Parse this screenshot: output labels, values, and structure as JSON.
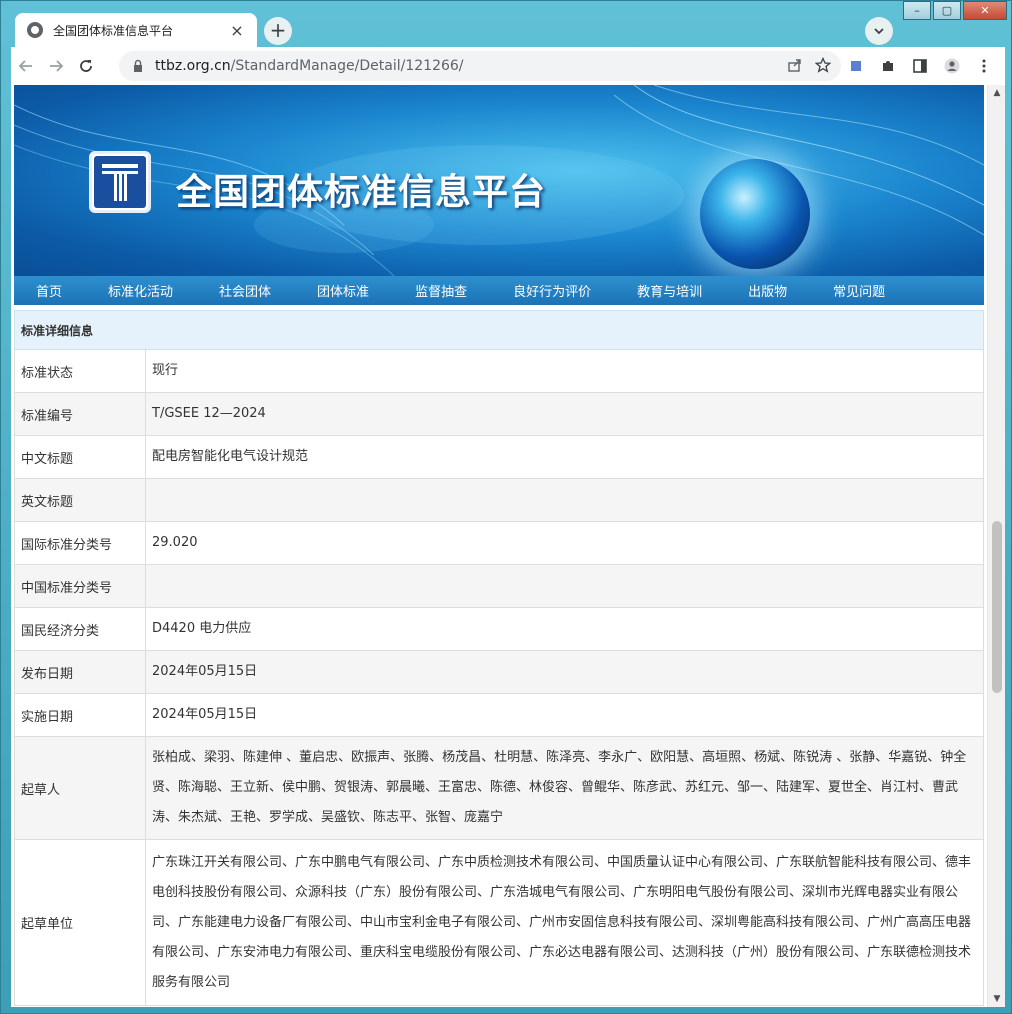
{
  "browser": {
    "tab_title": "全国团体标准信息平台",
    "url_host": "ttbz.org.cn",
    "url_path": "/StandardManage/Detail/121266/"
  },
  "site": {
    "title": "全国团体标准信息平台"
  },
  "nav": [
    "首页",
    "标准化活动",
    "社会团体",
    "团体标准",
    "监督抽查",
    "良好行为评价",
    "教育与培训",
    "出版物",
    "常见问题"
  ],
  "detail": {
    "header": "标准详细信息",
    "rows": [
      {
        "label": "标准状态",
        "value": "现行"
      },
      {
        "label": "标准编号",
        "value": "T/GSEE 12—2024"
      },
      {
        "label": "中文标题",
        "value": "配电房智能化电气设计规范"
      },
      {
        "label": "英文标题",
        "value": ""
      },
      {
        "label": "国际标准分类号",
        "value": "29.020"
      },
      {
        "label": "中国标准分类号",
        "value": ""
      },
      {
        "label": "国民经济分类",
        "value": "D4420 电力供应"
      },
      {
        "label": "发布日期",
        "value": "2024年05月15日"
      },
      {
        "label": "实施日期",
        "value": "2024年05月15日"
      },
      {
        "label": "起草人",
        "value": "张柏成、梁羽、陈建伸 、董启忠、欧振声、张腾、杨茂昌、杜明慧、陈泽亮、李永广、欧阳慧、高垣照、杨斌、陈锐涛 、张静、华嘉锐、钟全贤、陈海聪、王立新、侯中鹏、贺银涛、郭晨曦、王富忠、陈德、林俊容、曾鲲华、陈彦武、苏红元、邹一、陆建军、夏世全、肖江村、曹武涛、朱杰斌、王艳、罗学成、吴盛钦、陈志平、张智、庞嘉宁"
      },
      {
        "label": "起草单位",
        "value": "广东珠江开关有限公司、广东中鹏电气有限公司、广东中质检测技术有限公司、中国质量认证中心有限公司、广东联航智能科技有限公司、德丰电创科技股份有限公司、众源科技（广东）股份有限公司、广东浩城电气有限公司、广东明阳电气股份有限公司、深圳市光辉电器实业有限公司、广东能建电力设备厂有限公司、中山市宝利金电子有限公司、广州市安固信息科技有限公司、深圳粤能高科技有限公司、广州广高高压电器有限公司、广东安沛电力有限公司、重庆科宝电缆股份有限公司、广东必达电器有限公司、达测科技（广州）股份有限公司、广东联德检测技术服务有限公司"
      }
    ]
  }
}
